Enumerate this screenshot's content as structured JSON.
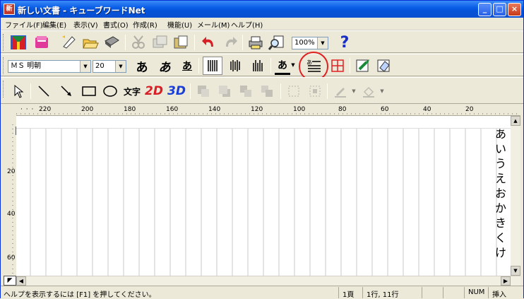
{
  "window": {
    "title": "新しい文書 - キューブワードNet",
    "app_icon": "新"
  },
  "menu": [
    "ファイル(F)",
    "編集(E)",
    "表示(V)",
    "書式(O)",
    "作成(R)",
    "機能(U)",
    "メール(M)",
    "ヘルプ(H)"
  ],
  "toolbar1": {
    "zoom": "100%"
  },
  "toolbar2": {
    "font_name": "ＭＳ 明朝",
    "font_size": "20",
    "bold_a": "あ",
    "italic_a": "あ",
    "underline_a": "あ",
    "color_a": "あ"
  },
  "toolbar3": {
    "text_label": "文字",
    "label_2d": "2D",
    "label_3d": "3D"
  },
  "ruler": {
    "h_ticks": [
      "220",
      "200",
      "180",
      "160",
      "140",
      "120",
      "100",
      "80",
      "60",
      "40",
      "20"
    ],
    "v_ticks": [
      "20",
      "40",
      "60"
    ]
  },
  "document": {
    "vertical_text": [
      "あ",
      "い",
      "う",
      "え",
      "お",
      "か",
      "き",
      "く",
      "け"
    ]
  },
  "status": {
    "help": "ヘルプを表示するには [F1] を押してください。",
    "page": "1頁",
    "position": "1行, 11行",
    "num": "NUM",
    "mode": "挿入"
  }
}
